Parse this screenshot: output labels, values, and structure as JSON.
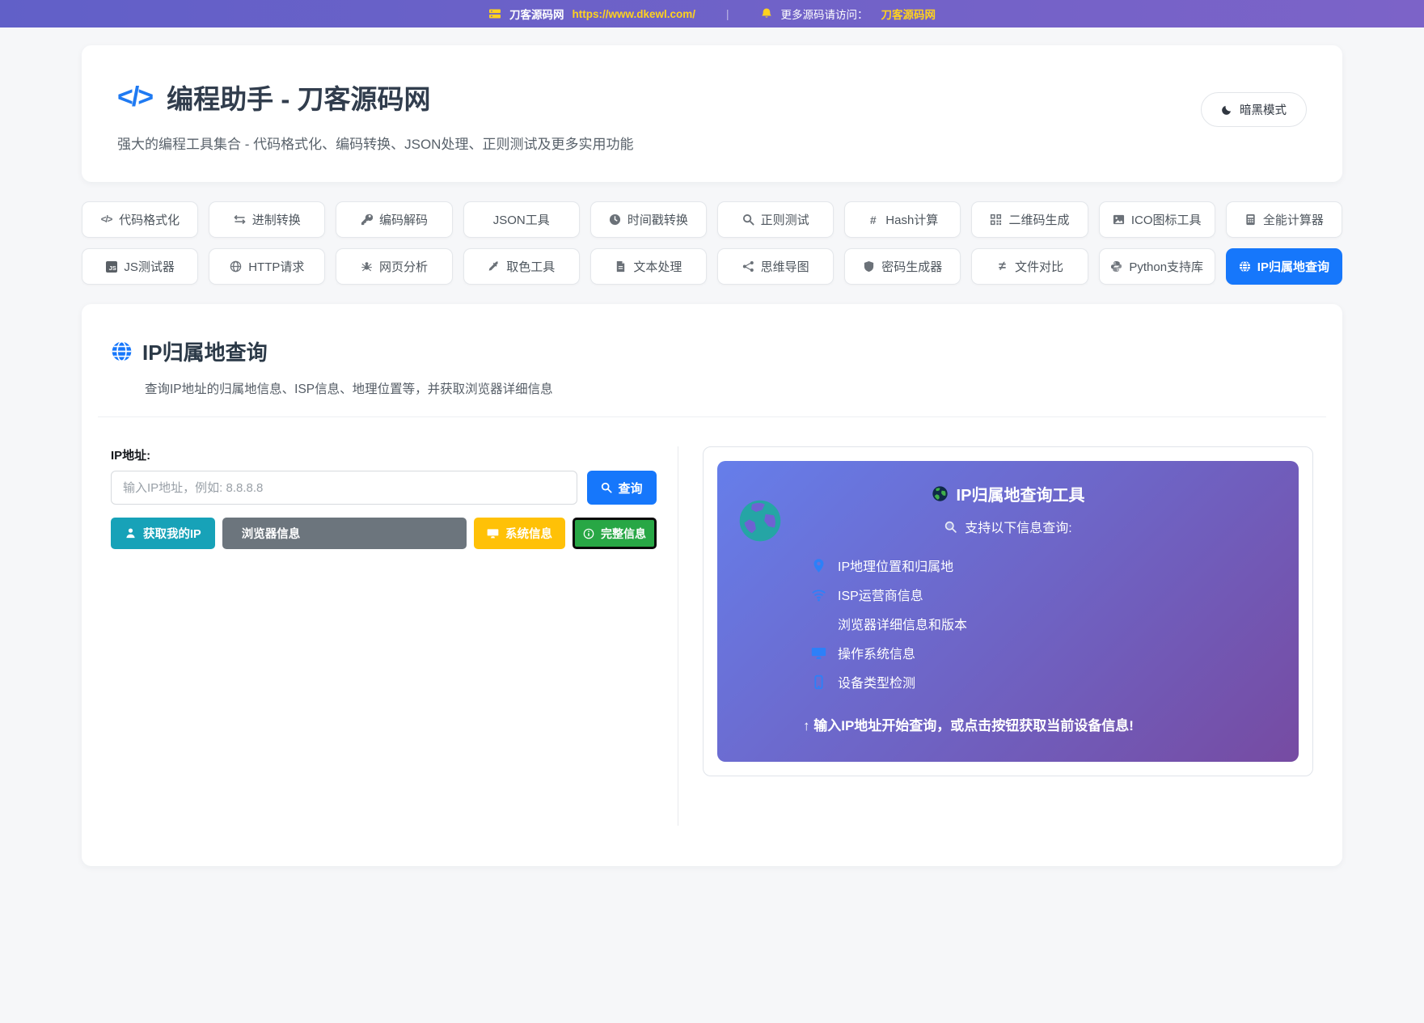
{
  "topbar": {
    "site_icon": "server-icon",
    "site_name": "刀客源码网",
    "site_url": "https://www.dkewl.com/",
    "separator": "|",
    "bell_icon": "bell-icon",
    "more_text": "更多源码请访问：",
    "more_link": "刀客源码网"
  },
  "header": {
    "code_glyph": "</>",
    "title": "编程助手 - 刀客源码网",
    "subtitle": "强大的编程工具集合 - 代码格式化、编码转换、JSON处理、正则测试及更多实用功能",
    "dark_mode_label": "暗黑模式"
  },
  "tabs": [
    {
      "name": "code-format",
      "label": "代码格式化",
      "icon": "code-icon",
      "active": false
    },
    {
      "name": "base-convert",
      "label": "进制转换",
      "icon": "exchange-icon",
      "active": false
    },
    {
      "name": "encode-decode",
      "label": "编码解码",
      "icon": "key-icon",
      "active": false
    },
    {
      "name": "json-tools",
      "label": "JSON工具",
      "icon": "",
      "active": false
    },
    {
      "name": "timestamp-convert",
      "label": "时间戳转换",
      "icon": "clock-icon",
      "active": false
    },
    {
      "name": "regex-test",
      "label": "正则测试",
      "icon": "search-icon",
      "active": false
    },
    {
      "name": "hash-calc",
      "label": "Hash计算",
      "icon": "hash-icon",
      "active": false
    },
    {
      "name": "qrcode-gen",
      "label": "二维码生成",
      "icon": "qrcode-icon",
      "active": false
    },
    {
      "name": "ico-tools",
      "label": "ICO图标工具",
      "icon": "image-icon",
      "active": false
    },
    {
      "name": "calculator",
      "label": "全能计算器",
      "icon": "calculator-icon",
      "active": false
    },
    {
      "name": "js-tester",
      "label": "JS测试器",
      "icon": "js-icon",
      "active": false
    },
    {
      "name": "http-request",
      "label": "HTTP请求",
      "icon": "globe-stroke-icon",
      "active": false
    },
    {
      "name": "web-analysis",
      "label": "网页分析",
      "icon": "spider-icon",
      "active": false
    },
    {
      "name": "color-picker",
      "label": "取色工具",
      "icon": "eyedropper-icon",
      "active": false
    },
    {
      "name": "text-process",
      "label": "文本处理",
      "icon": "file-icon",
      "active": false
    },
    {
      "name": "mind-map",
      "label": "思维导图",
      "icon": "sitemap-icon",
      "active": false
    },
    {
      "name": "password-gen",
      "label": "密码生成器",
      "icon": "shield-icon",
      "active": false
    },
    {
      "name": "file-diff",
      "label": "文件对比",
      "icon": "not-equal-icon",
      "active": false
    },
    {
      "name": "python-lib",
      "label": "Python支持库",
      "icon": "python-icon",
      "active": false
    },
    {
      "name": "ip-lookup",
      "label": "IP归属地查询",
      "icon": "globe-meridian-icon",
      "active": true
    }
  ],
  "tool": {
    "title": "IP归属地查询",
    "subtitle": "查询IP地址的归属地信息、ISP信息、地理位置等，并获取浏览器详细信息",
    "ip_label": "IP地址:",
    "ip_placeholder": "输入IP地址，例如: 8.8.8.8",
    "query_button": "查询",
    "buttons": {
      "my_ip": "获取我的IP",
      "browser": "浏览器信息",
      "system": "系统信息",
      "full": "完整信息"
    },
    "panel": {
      "title": "IP归属地查询工具",
      "title_icon": "earth-icon",
      "subtitle": "支持以下信息查询:",
      "subtitle_icon": "magnifier-light-icon",
      "items": [
        {
          "icon": "location-pin-icon",
          "text": "IP地理位置和归属地"
        },
        {
          "icon": "wifi-icon",
          "text": "ISP运营商信息"
        },
        {
          "icon": "",
          "text": "浏览器详细信息和版本"
        },
        {
          "icon": "monitor-icon",
          "text": "操作系统信息"
        },
        {
          "icon": "mobile-icon",
          "text": "设备类型检测"
        }
      ],
      "footer": "↑ 输入IP地址开始查询，或点击按钮获取当前设备信息!"
    }
  },
  "colors": {
    "accent_blue": "#1677fb",
    "teal": "#17a2b8",
    "gray": "#6c757d",
    "yellow": "#ffc107",
    "green": "#28a745",
    "topbar_gradient": [
      "#6160c8",
      "#7c63c8"
    ],
    "panel_gradient": [
      "#667eea",
      "#764ba2"
    ],
    "link_yellow": "#ffd21e",
    "page_bg": "#f6f7f9"
  }
}
